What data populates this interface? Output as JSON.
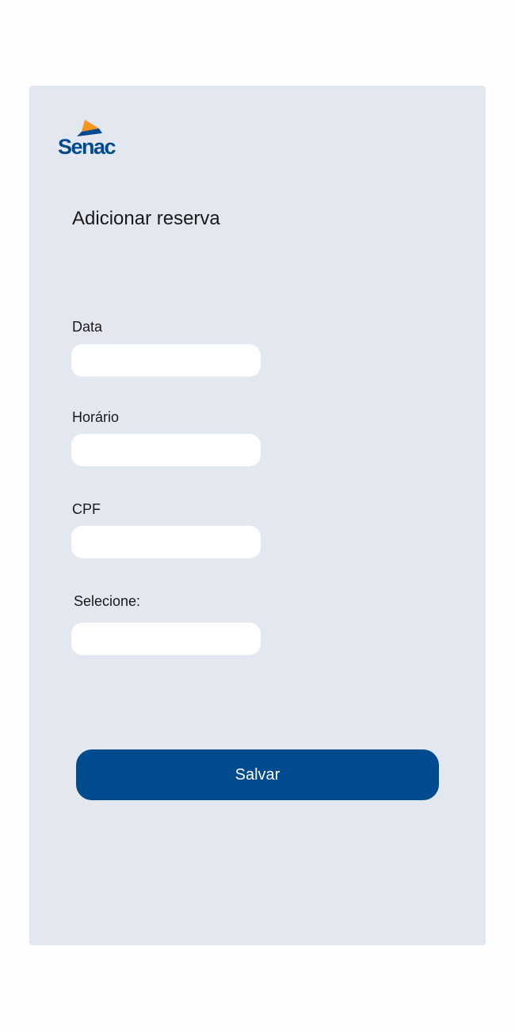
{
  "brand": {
    "name": "Senac",
    "colors": {
      "primary": "#004b8d",
      "accent": "#f7941d",
      "card_background": "#e3e7f0"
    }
  },
  "form": {
    "title": "Adicionar reserva",
    "fields": [
      {
        "label": "Data",
        "value": "",
        "placeholder": ""
      },
      {
        "label": "Horário",
        "value": "",
        "placeholder": ""
      },
      {
        "label": "CPF",
        "value": "",
        "placeholder": ""
      },
      {
        "label": "Selecione:",
        "value": "",
        "placeholder": ""
      }
    ],
    "save_label": "Salvar"
  }
}
